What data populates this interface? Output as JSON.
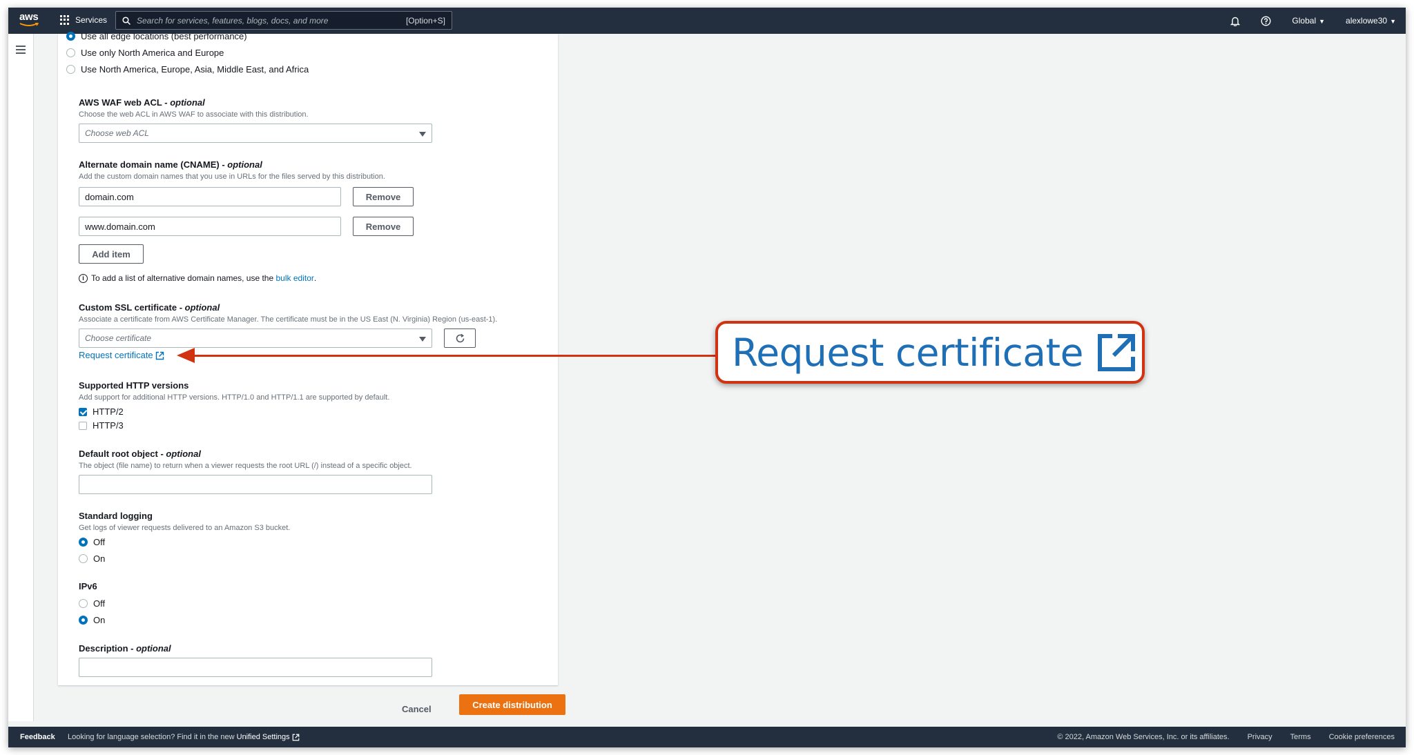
{
  "nav": {
    "logo": "aws",
    "services_label": "Services",
    "search_placeholder": "Search for services, features, blogs, docs, and more",
    "search_shortcut": "[Option+S]",
    "region": "Global",
    "user": "alexlowe30"
  },
  "price_class": {
    "options": [
      {
        "label": "Use all edge locations (best performance)",
        "selected": true
      },
      {
        "label": "Use only North America and Europe",
        "selected": false
      },
      {
        "label": "Use North America, Europe, Asia, Middle East, and Africa",
        "selected": false
      }
    ]
  },
  "waf": {
    "title": "AWS WAF web ACL",
    "optional": "optional",
    "description": "Choose the web ACL in AWS WAF to associate with this distribution.",
    "placeholder": "Choose web ACL"
  },
  "cname": {
    "title": "Alternate domain name (CNAME)",
    "optional": "optional",
    "description": "Add the custom domain names that you use in URLs for the files served by this distribution.",
    "items": [
      "domain.com",
      "www.domain.com"
    ],
    "remove_label": "Remove",
    "add_item_label": "Add item",
    "info_text": "To add a list of alternative domain names, use the",
    "info_link": "bulk editor",
    "info_period": "."
  },
  "ssl": {
    "title": "Custom SSL certificate",
    "optional": "optional",
    "description": "Associate a certificate from AWS Certificate Manager. The certificate must be in the US East (N. Virginia) Region (us-east-1).",
    "placeholder": "Choose certificate",
    "request_link": "Request certificate"
  },
  "http_versions": {
    "title": "Supported HTTP versions",
    "description": "Add support for additional HTTP versions. HTTP/1.0 and HTTP/1.1 are supported by default.",
    "options": [
      {
        "label": "HTTP/2",
        "checked": true
      },
      {
        "label": "HTTP/3",
        "checked": false
      }
    ]
  },
  "root_object": {
    "title": "Default root object",
    "optional": "optional",
    "description": "The object (file name) to return when a viewer requests the root URL (/) instead of a specific object.",
    "value": ""
  },
  "logging": {
    "title": "Standard logging",
    "description": "Get logs of viewer requests delivered to an Amazon S3 bucket.",
    "options": [
      {
        "label": "Off",
        "selected": true
      },
      {
        "label": "On",
        "selected": false
      }
    ]
  },
  "ipv6": {
    "title": "IPv6",
    "options": [
      {
        "label": "Off",
        "selected": false
      },
      {
        "label": "On",
        "selected": true
      }
    ]
  },
  "description_field": {
    "title": "Description",
    "optional": "optional",
    "value": ""
  },
  "actions": {
    "cancel": "Cancel",
    "create": "Create distribution"
  },
  "footer": {
    "feedback": "Feedback",
    "language_text": "Looking for language selection? Find it in the new",
    "language_link": "Unified Settings",
    "copyright": "© 2022, Amazon Web Services, Inc. or its affiliates.",
    "privacy": "Privacy",
    "terms": "Terms",
    "cookies": "Cookie preferences"
  },
  "callout": {
    "text": "Request certificate"
  },
  "colors": {
    "nav_bg": "#232f3e",
    "link": "#0073bb",
    "primary_button": "#ec7211",
    "callout_border": "#d13212"
  }
}
